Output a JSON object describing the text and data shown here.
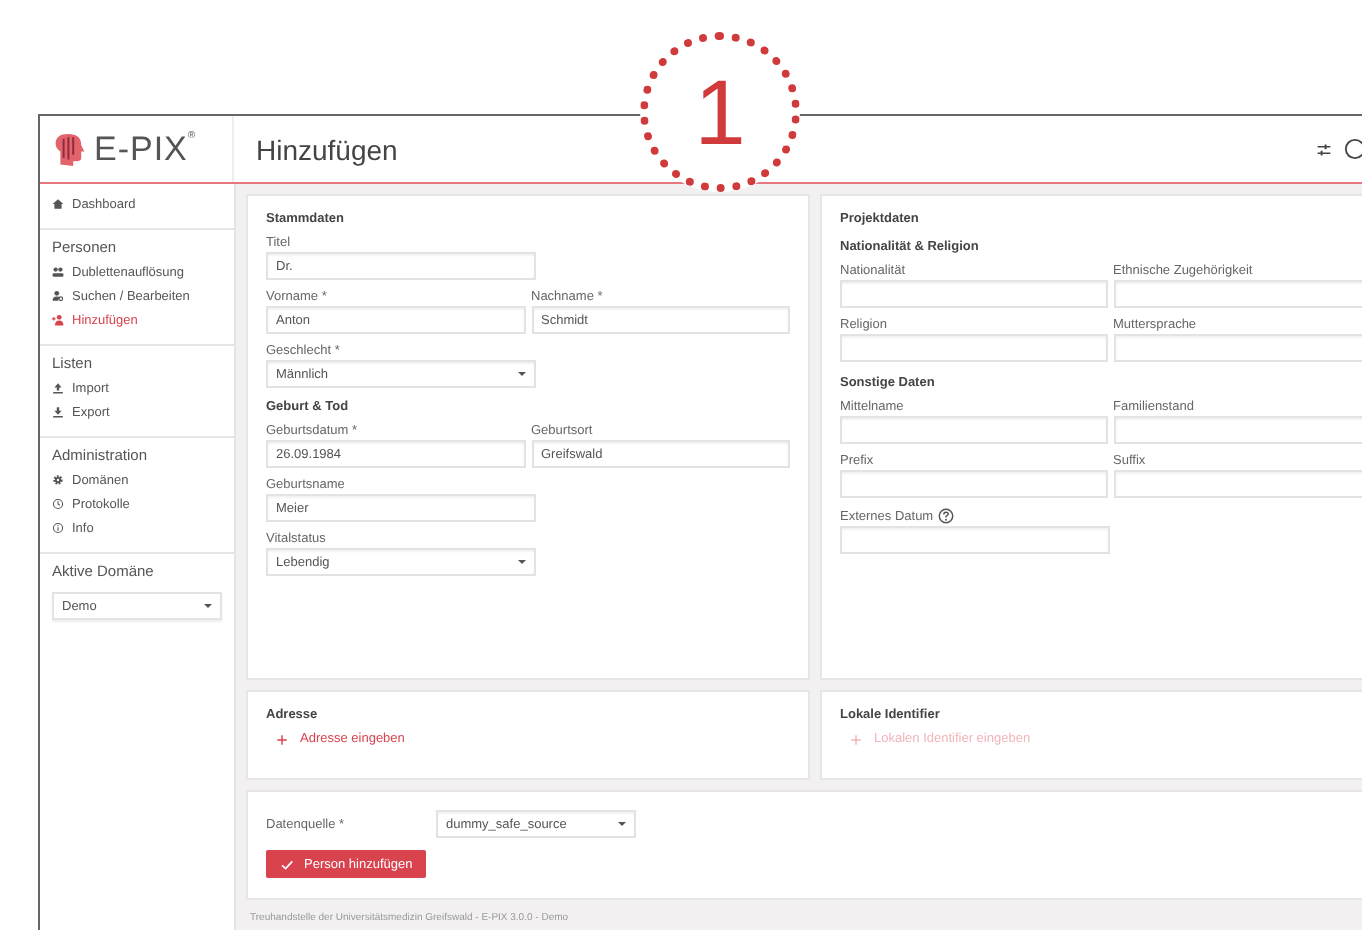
{
  "callout": {
    "label": "1"
  },
  "header": {
    "logo": {
      "name": "E-PIX",
      "mark": "®"
    },
    "title": "Hinzufügen"
  },
  "sidebar": {
    "items": [
      {
        "kind": "item",
        "label": "Dashboard",
        "selected": false
      },
      {
        "kind": "section",
        "label": "Personen"
      },
      {
        "kind": "item",
        "label": "Dublettenauflösung",
        "selected": false
      },
      {
        "kind": "item",
        "label": "Suchen / Bearbeiten",
        "selected": false
      },
      {
        "kind": "item",
        "label": "Hinzufügen",
        "selected": true
      },
      {
        "kind": "section",
        "label": "Listen"
      },
      {
        "kind": "item",
        "label": "Import",
        "selected": false
      },
      {
        "kind": "item",
        "label": "Export",
        "selected": false
      },
      {
        "kind": "section",
        "label": "Administration"
      },
      {
        "kind": "item",
        "label": "Domänen",
        "selected": false
      },
      {
        "kind": "item",
        "label": "Protokolle",
        "selected": false
      },
      {
        "kind": "item",
        "label": "Info",
        "selected": false
      },
      {
        "kind": "section",
        "label": "Aktive Domäne"
      },
      {
        "kind": "select",
        "value": "Demo"
      }
    ]
  },
  "left_card": {
    "groups": [
      {
        "title": "Stammdaten",
        "rows": [
          [
            {
              "kind": "input",
              "label": "Titel",
              "value": "Dr."
            }
          ],
          [
            {
              "kind": "input",
              "label": "Vorname *",
              "value": "Anton"
            },
            {
              "kind": "input",
              "label": "Nachname *",
              "value": "Schmidt"
            }
          ],
          [
            {
              "kind": "select",
              "label": "Geschlecht *",
              "value": "Männlich"
            }
          ]
        ]
      },
      {
        "title": "Geburt & Tod",
        "rows": [
          [
            {
              "kind": "input",
              "label": "Geburtsdatum *",
              "value": "26.09.1984"
            },
            {
              "kind": "input",
              "label": "Geburtsort",
              "value": "Greifswald"
            }
          ],
          [
            {
              "kind": "input",
              "label": "Geburtsname",
              "value": "Meier"
            }
          ],
          [
            {
              "kind": "select",
              "label": "Vitalstatus",
              "value": "Lebendig"
            }
          ]
        ]
      }
    ]
  },
  "right_card": {
    "title": "Projektdaten",
    "groups": [
      {
        "title": "Nationalität & Religion",
        "rows": [
          [
            {
              "kind": "input",
              "label": "Nationalität"
            },
            {
              "kind": "input",
              "label": "Ethnische Zugehörigkeit"
            }
          ],
          [
            {
              "kind": "input",
              "label": "Religion"
            },
            {
              "kind": "input",
              "label": "Muttersprache"
            }
          ]
        ]
      },
      {
        "title": "Sonstige Daten",
        "rows": [
          [
            {
              "kind": "input",
              "label": "Mittelname"
            },
            {
              "kind": "input",
              "label": "Familienstand"
            }
          ],
          [
            {
              "kind": "input",
              "label": "Prefix"
            },
            {
              "kind": "input",
              "label": "Suffix"
            }
          ],
          [
            {
              "kind": "input",
              "label": "Externes Datum",
              "help": true
            }
          ]
        ]
      }
    ]
  },
  "address_card": {
    "title": "Adresse",
    "link": {
      "label": "Adresse eingeben",
      "disabled": false
    }
  },
  "identifier_card": {
    "title": "Lokale Identifier",
    "link": {
      "label": "Lokalen Identifier eingeben",
      "disabled": true
    }
  },
  "source_card": {
    "label": "Datenquelle *",
    "value": "dummy_safe_source",
    "button": "Person hinzufügen"
  },
  "footer": "Treuhandstelle der Universitätsmedizin Greifswald - E-PIX 3.0.0 - Demo"
}
